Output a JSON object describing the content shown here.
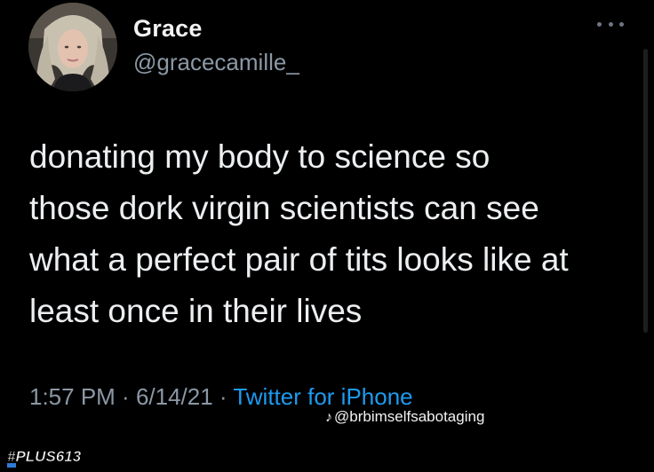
{
  "author": {
    "display_name": "Grace",
    "handle": "@gracecamille_"
  },
  "tweet": {
    "lines": [
      "donating my body to science so",
      "those dork virgin scientists can see",
      "what a perfect pair of tits looks like at",
      "least once in their lives"
    ],
    "time": "1:57 PM",
    "date": "6/14/21",
    "separator": " · ",
    "source": "Twitter for iPhone"
  },
  "overlay": {
    "watermark": "@brbimselfsabotaging",
    "watermark_icon": "tiktok-icon",
    "logo_text": "#PLUS613"
  },
  "colors": {
    "background": "#000000",
    "text": "#eceff1",
    "muted": "#8b98a5",
    "link": "#1d9bf0"
  },
  "icons": {
    "more": "more-horizontal-icon"
  }
}
